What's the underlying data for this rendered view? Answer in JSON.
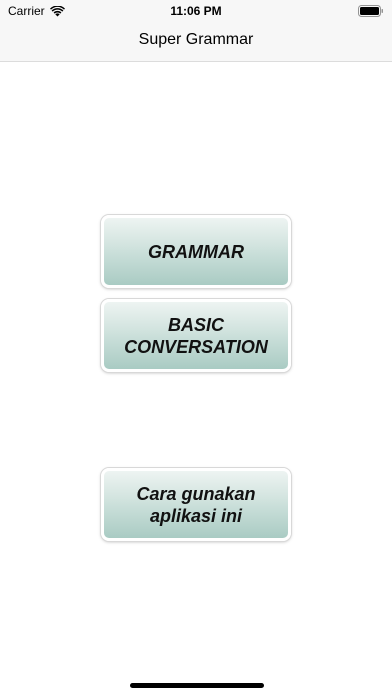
{
  "status_bar": {
    "carrier": "Carrier",
    "time": "11:06 PM"
  },
  "nav": {
    "title": "Super Grammar"
  },
  "menu": {
    "grammar_label": "GRAMMAR",
    "basic_conversation_label": "BASIC\nCONVERSATION",
    "how_to_use_label": "Cara gunakan\naplikasi ini"
  },
  "icons": {
    "wifi": "wifi-icon",
    "battery": "battery-icon"
  },
  "colors": {
    "button_gradient_top": "#eef4f2",
    "button_gradient_bottom": "#a9cbc3",
    "header_bg": "#f7f7f7"
  }
}
